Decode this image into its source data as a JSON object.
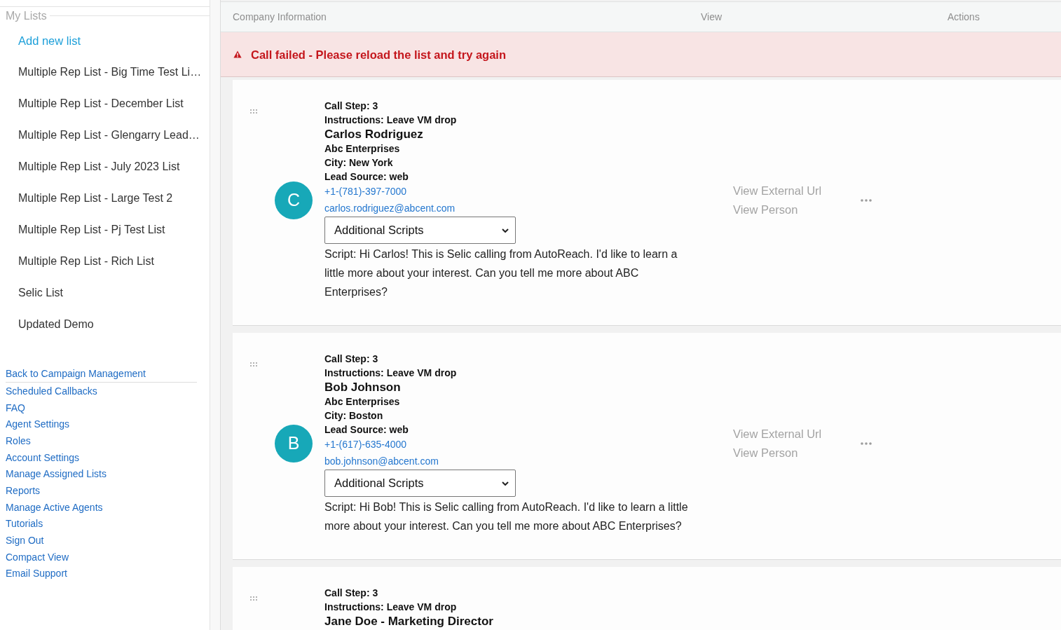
{
  "sidebar": {
    "section_title": "My Lists",
    "add_list_link": "Add new list",
    "lists": [
      "Multiple Rep List - Big Time Test Li…",
      "Multiple Rep List - December List",
      "Multiple Rep List - Glengarry Lead…",
      "Multiple Rep List - July 2023 List",
      "Multiple Rep List - Large Test 2",
      "Multiple Rep List - Pj Test List",
      "Multiple Rep List - Rich List",
      "Selic List",
      "Updated Demo"
    ],
    "links": [
      "Back to Campaign Management",
      "Scheduled Callbacks",
      "FAQ",
      "Agent Settings",
      "Roles",
      "Account Settings",
      "Manage Assigned Lists",
      "Reports",
      "Manage Active Agents",
      "Tutorials",
      "Sign Out",
      "Compact View",
      "Email Support"
    ]
  },
  "table": {
    "columns": [
      "Company Information",
      "View",
      "Actions"
    ],
    "alert": "Call failed - Please reload the list and try again",
    "rows": [
      {
        "avatar": "C",
        "call_step": "Call Step: 3",
        "instructions": "Instructions: Leave VM drop",
        "name": "Carlos Rodriguez",
        "company": "Abc Enterprises",
        "city": "City: New York",
        "lead_source": "Lead Source: web",
        "phone": "+1-(781)-397-7000",
        "email": "carlos.rodriguez@abcent.com",
        "script_menu": "Additional Scripts",
        "script": "Script: Hi Carlos! This is Selic calling from AutoReach. I'd like to learn a little more about your interest. Can you tell me more about ABC Enterprises?",
        "view_links": [
          "View External Url",
          "View Person"
        ]
      },
      {
        "avatar": "B",
        "call_step": "Call Step: 3",
        "instructions": "Instructions: Leave VM drop",
        "name": "Bob Johnson",
        "company": "Abc Enterprises",
        "city": "City: Boston",
        "lead_source": "Lead Source: web",
        "phone": "+1-(617)-635-4000",
        "email": "bob.johnson@abcent.com",
        "script_menu": "Additional Scripts",
        "script": "Script: Hi Bob! This is Selic calling from AutoReach. I'd like to learn a little more about your interest. Can you tell me more about ABC Enterprises?",
        "view_links": [
          "View External Url",
          "View Person"
        ]
      },
      {
        "call_step": "Call Step: 3",
        "instructions": "Instructions: Leave VM drop",
        "name": "Jane Doe - Marketing Director"
      }
    ]
  }
}
